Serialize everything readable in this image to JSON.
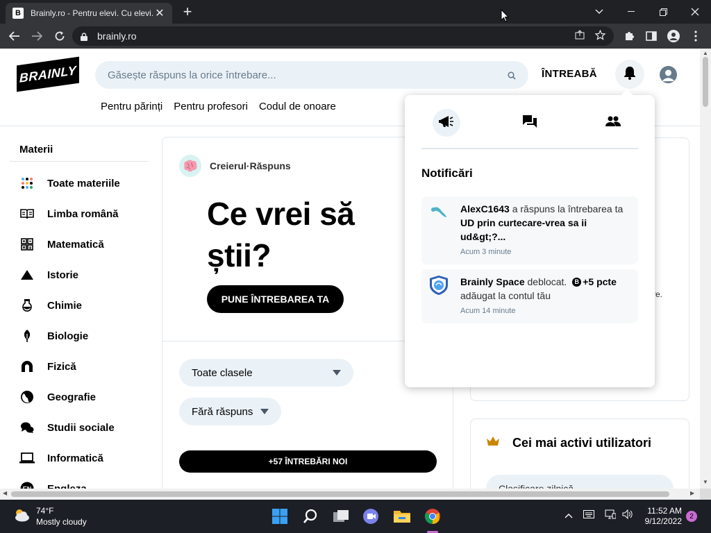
{
  "browser": {
    "tab_title": "Brainly.ro - Pentru elevi. Cu elevi.",
    "tab_favicon": "B",
    "url": "brainly.ro",
    "new_tab": "+",
    "tab_close": "✕"
  },
  "header": {
    "logo": "BRAINLY",
    "search_placeholder": "Găsește răspuns la orice întrebare...",
    "ask_label": "ÎNTREABĂ",
    "subnav": [
      "Pentru părinți",
      "Pentru profesori",
      "Codul de onoare"
    ]
  },
  "sidebar": {
    "title": "Materii",
    "items": [
      {
        "label": "Toate materiile",
        "icon": "all-subjects-icon"
      },
      {
        "label": "Limba română",
        "icon": "book-icon"
      },
      {
        "label": "Matematică",
        "icon": "math-icon"
      },
      {
        "label": "Istorie",
        "icon": "pyramid-icon"
      },
      {
        "label": "Chimie",
        "icon": "flask-icon"
      },
      {
        "label": "Biologie",
        "icon": "leaf-icon"
      },
      {
        "label": "Fizică",
        "icon": "magnet-icon"
      },
      {
        "label": "Geografie",
        "icon": "globe-icon"
      },
      {
        "label": "Studii sociale",
        "icon": "chat-icon"
      },
      {
        "label": "Informatică",
        "icon": "laptop-icon"
      },
      {
        "label": "Engleza",
        "icon": "en-icon"
      }
    ]
  },
  "main": {
    "author": "Creierul",
    "dot": "·",
    "author_label": "Răspuns",
    "hero": "Ce vrei să știi?",
    "ask_button": "PUNE ÎNTREBAREA TA",
    "grade_select": "Toate clasele",
    "answer_select": "Fără răspuns",
    "new_questions": "+57 ÎNTREBĂRI NOI"
  },
  "right": {
    "fragment": "re.",
    "active_users_title": "Cei mai activi utilizatori",
    "ranking_select": "Clasificare zilnică"
  },
  "notifications": {
    "title": "Notificări",
    "items": [
      {
        "user": "AlexC1643",
        "text": " a răspuns la întrebarea ta ",
        "question": "UD prin curtecare-vrea sa ii ud&gt;?...",
        "time": "Acum 3 minute"
      },
      {
        "user": "Brainly Space",
        "text": " deblocat. ",
        "points": "+5 pcte",
        "points_icon": "B",
        "text2": "adăugat la contul tău",
        "time": "Acum 14 minute"
      }
    ]
  },
  "taskbar": {
    "temperature": "74°F",
    "weather": "Mostly cloudy",
    "time": "11:52 AM",
    "date": "9/12/2022",
    "notification_count": "2"
  },
  "colors": {
    "accent_light": "#ebf2f7",
    "chrome_dark": "#202124",
    "chrome_mid": "#35363a"
  }
}
